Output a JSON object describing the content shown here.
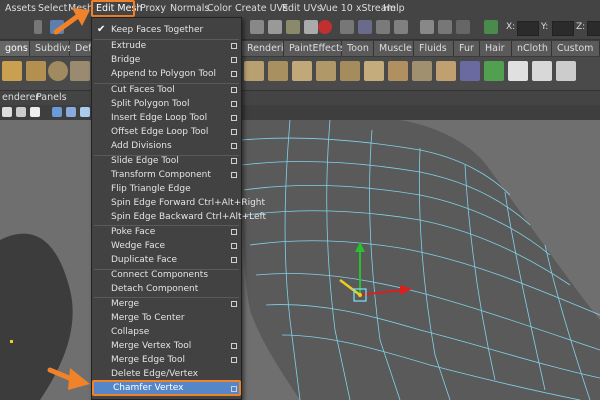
{
  "menubar": {
    "items": [
      "Assets",
      "Select",
      "Mesh",
      "Edit Mesh",
      "Proxy",
      "Normals",
      "Color",
      "Create UVs",
      "Edit UVs",
      "Vue 10 xStream",
      "Help"
    ]
  },
  "statusline": {
    "x_label": "X:",
    "y_label": "Y:",
    "z_label": "Z:"
  },
  "shelf_tabs": [
    "gons",
    "Subdivs",
    "Defo",
    "Rendering",
    "PaintEffects",
    "Toon",
    "Muscle",
    "Fluids",
    "Fur",
    "Hair",
    "nCloth",
    "Custom"
  ],
  "panel_menu": [
    "enderer",
    "Panels"
  ],
  "edit_mesh_menu": {
    "items": [
      {
        "label": "Keep Faces Together",
        "checked": true,
        "option": false
      },
      {
        "label": "Extrude",
        "option": true
      },
      {
        "label": "Bridge",
        "option": true
      },
      {
        "label": "Append to Polygon Tool",
        "option": true
      },
      {
        "label": "Cut Faces Tool",
        "option": true
      },
      {
        "label": "Split Polygon Tool",
        "option": true
      },
      {
        "label": "Insert Edge Loop Tool",
        "option": true
      },
      {
        "label": "Offset Edge Loop Tool",
        "option": true
      },
      {
        "label": "Add Divisions",
        "option": true
      },
      {
        "label": "Slide Edge Tool",
        "option": true
      },
      {
        "label": "Transform Component",
        "option": true
      },
      {
        "label": "Flip Triangle Edge",
        "option": false
      },
      {
        "label": "Spin Edge Forward  Ctrl+Alt+Right",
        "option": false
      },
      {
        "label": "Spin Edge Backward  Ctrl+Alt+Left",
        "option": false
      },
      {
        "label": "Poke Face",
        "option": true
      },
      {
        "label": "Wedge Face",
        "option": true
      },
      {
        "label": "Duplicate Face",
        "option": true
      },
      {
        "label": "Connect Components",
        "option": false
      },
      {
        "label": "Detach Component",
        "option": false
      },
      {
        "label": "Merge",
        "option": true
      },
      {
        "label": "Merge To Center",
        "option": false
      },
      {
        "label": "Collapse",
        "option": false
      },
      {
        "label": "Merge Vertex Tool",
        "option": true
      },
      {
        "label": "Merge Edge Tool",
        "option": true
      },
      {
        "label": "Delete Edge/Vertex",
        "option": false
      },
      {
        "label": "Chamfer Vertex",
        "option": true,
        "highlighted": true
      }
    ]
  },
  "colors": {
    "accent_orange": "#f0822a",
    "highlight_blue": "#5587c8",
    "wire_cyan": "#7fd3e8",
    "manip_x_red": "#d82020",
    "manip_y_green": "#28c030",
    "manip_z_yellow": "#e8d020"
  }
}
